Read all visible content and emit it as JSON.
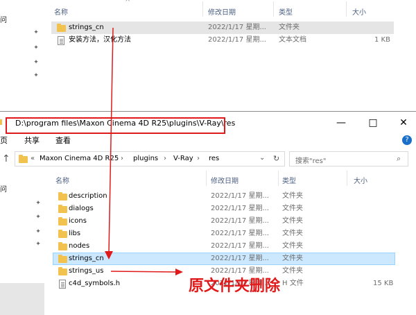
{
  "top_window": {
    "nav_fragment": "问",
    "columns": {
      "name": "名称",
      "modified": "修改日期",
      "type": "类型",
      "size": "大小"
    },
    "rows": [
      {
        "icon": "folder-icon",
        "name": "strings_cn",
        "modified": "2022/1/17 星期...",
        "type": "文件夹",
        "size": ""
      },
      {
        "icon": "text-file-icon",
        "name": "安装方法，汉化方法",
        "modified": "2022/1/17 星期...",
        "type": "文本文档",
        "size": "1 KB"
      }
    ]
  },
  "bottom_window": {
    "title_path": "D:\\program files\\Maxon Cinema 4D R25\\plugins\\V-Ray\\res",
    "window_controls": {
      "minimize": "—",
      "maximize": "□",
      "close": "✕"
    },
    "ribbon": {
      "tab_fragment": "页",
      "share": "共享",
      "view": "查看",
      "help": "?"
    },
    "address": {
      "overflow": "«",
      "crumbs": [
        "Maxon Cinema 4D R25",
        "plugins",
        "V-Ray",
        "res"
      ],
      "separator": "›"
    },
    "search": {
      "placeholder": "搜索\"res\""
    },
    "nav_fragment": "问",
    "columns": {
      "name": "名称",
      "modified": "修改日期",
      "type": "类型",
      "size": "大小"
    },
    "rows": [
      {
        "icon": "folder-icon",
        "name": "description",
        "modified": "2022/1/17 星期...",
        "type": "文件夹",
        "size": ""
      },
      {
        "icon": "folder-icon",
        "name": "dialogs",
        "modified": "2022/1/17 星期...",
        "type": "文件夹",
        "size": ""
      },
      {
        "icon": "folder-icon",
        "name": "icons",
        "modified": "2022/1/17 星期...",
        "type": "文件夹",
        "size": ""
      },
      {
        "icon": "folder-icon",
        "name": "libs",
        "modified": "2022/1/17 星期...",
        "type": "文件夹",
        "size": ""
      },
      {
        "icon": "folder-icon",
        "name": "nodes",
        "modified": "2022/1/17 星期...",
        "type": "文件夹",
        "size": ""
      },
      {
        "icon": "folder-icon",
        "name": "strings_cn",
        "modified": "2022/1/17 星期...",
        "type": "文件夹",
        "size": ""
      },
      {
        "icon": "folder-icon",
        "name": "strings_us",
        "modified": "2022/1/17 星期...",
        "type": "文件夹",
        "size": ""
      },
      {
        "icon": "text-file-icon",
        "name": "c4d_symbols.h",
        "modified": "2022/1/17 星期...",
        "type": "H 文件",
        "size": "15 KB"
      }
    ]
  },
  "annotation": {
    "text": "原文件夹删除",
    "color": "#e01a1a"
  }
}
